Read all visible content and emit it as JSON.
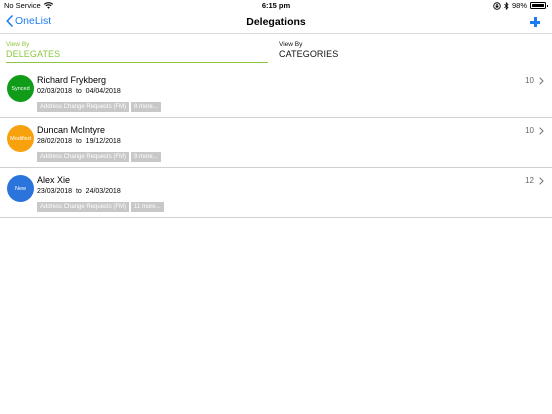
{
  "status_bar": {
    "carrier": "No Service",
    "time": "6:15 pm",
    "battery": "98%",
    "battery_level": 0.98
  },
  "nav": {
    "back_label": "OneList",
    "title": "Delegations"
  },
  "view_by": {
    "caption": "View By",
    "options": [
      {
        "label": "DELEGATES",
        "selected": true
      },
      {
        "label": "CATEGORIES",
        "selected": false
      }
    ]
  },
  "colors": {
    "accent_blue": "#1e7cf2",
    "selected_green": "#8cc63f",
    "status_synced": "#109b19",
    "status_modified": "#f7a10c",
    "status_new": "#2b74dc",
    "tag_gray": "#c8c8c8"
  },
  "delegations": [
    {
      "status": "Synced",
      "status_color": "#109b19",
      "name": "Richard Frykberg",
      "start_date": "02/03/2018",
      "date_separator": "to",
      "end_date": "04/04/2018",
      "primary_tag": "Address Change Requests (FM)",
      "more_tag": "8 more...",
      "count": "10"
    },
    {
      "status": "Modified",
      "status_color": "#f7a10c",
      "name": "Duncan McIntyre",
      "start_date": "28/02/2018",
      "date_separator": "to",
      "end_date": "19/12/2018",
      "primary_tag": "Address Change Requests (FM)",
      "more_tag": "9 more...",
      "count": "10"
    },
    {
      "status": "New",
      "status_color": "#2b74dc",
      "name": "Alex Xie",
      "start_date": "23/03/2018",
      "date_separator": "to",
      "end_date": "24/03/2018",
      "primary_tag": "Address Change Requests (FM)",
      "more_tag": "11 more...",
      "count": "12"
    }
  ]
}
